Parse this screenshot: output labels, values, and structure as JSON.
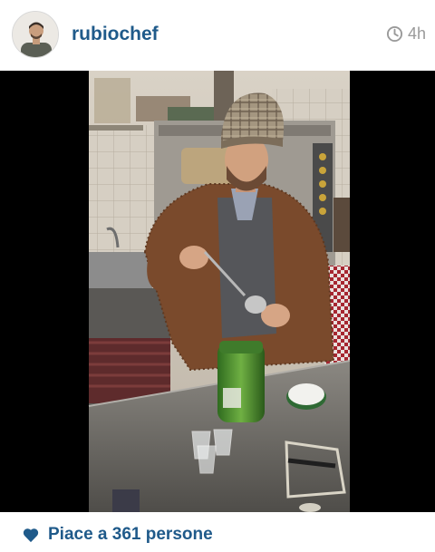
{
  "post": {
    "username": "rubiochef",
    "time_ago": "4h",
    "likes_text": "Piace a 361 persone"
  },
  "icons": {
    "avatar": "profile-photo",
    "time": "clock-icon",
    "likes": "heart-icon"
  },
  "colors": {
    "link_blue": "#1f5a8a",
    "meta_gray": "#9a9a9a",
    "photo_bg": "#000000"
  }
}
